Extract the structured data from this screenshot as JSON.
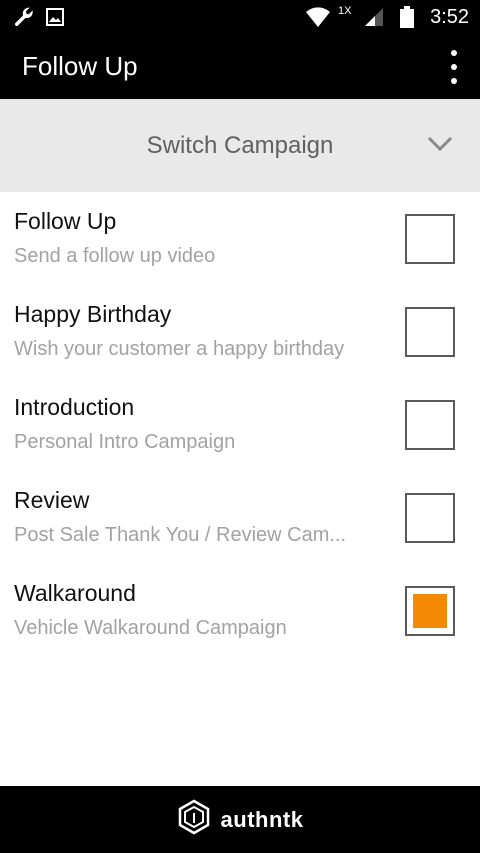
{
  "status_bar": {
    "time": "3:52",
    "network_label": "1X",
    "icons": [
      "wrench-icon",
      "image-icon",
      "wifi-icon",
      "signal-icon",
      "battery-icon"
    ]
  },
  "app_bar": {
    "title": "Follow Up",
    "overflow_icon": "more-vert-icon"
  },
  "switch_campaign": {
    "label": "Switch Campaign",
    "icon": "chevron-down-icon"
  },
  "campaigns": [
    {
      "title": "Follow Up",
      "subtitle": "Send a follow up video",
      "checked": false
    },
    {
      "title": "Happy Birthday",
      "subtitle": "Wish your customer a happy birthday",
      "checked": false
    },
    {
      "title": "Introduction",
      "subtitle": "Personal Intro Campaign",
      "checked": false
    },
    {
      "title": "Review",
      "subtitle": "Post Sale Thank You / Review Cam...",
      "checked": false
    },
    {
      "title": "Walkaround",
      "subtitle": "Vehicle Walkaround Campaign",
      "checked": true
    }
  ],
  "footer": {
    "brand": "authntk",
    "logo_icon": "authntk-logo-icon"
  },
  "colors": {
    "bar_background": "#000000",
    "switch_background": "#e9e9e9",
    "checked_fill": "#f58a07",
    "subtitle_text": "#a2a2a2"
  }
}
